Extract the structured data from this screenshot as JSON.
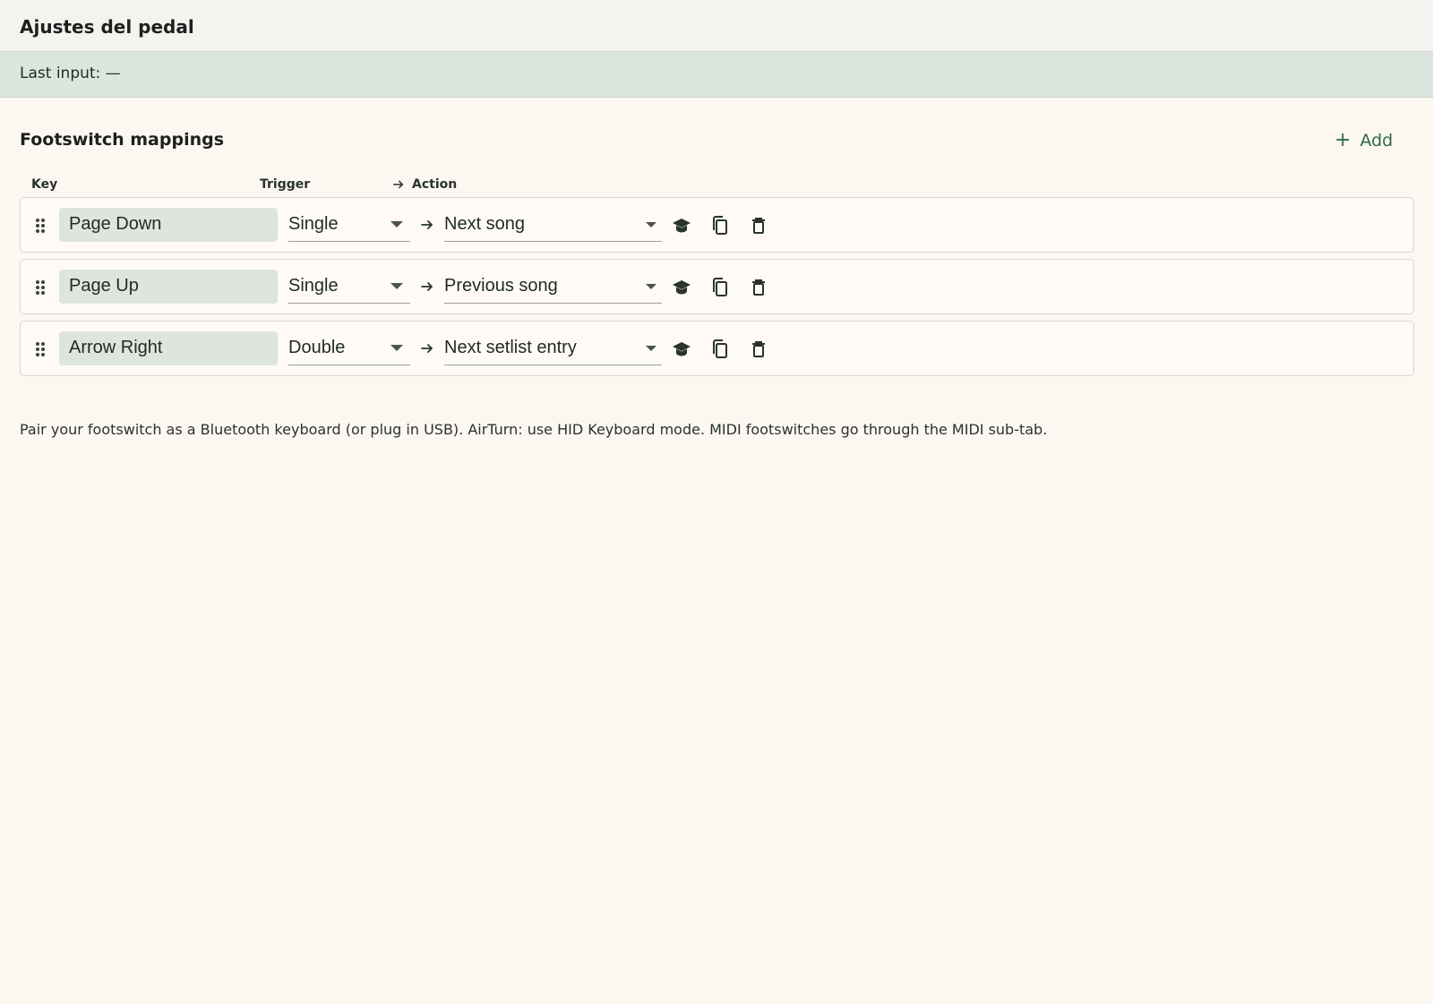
{
  "header": {
    "title": "Ajustes del pedal"
  },
  "status": {
    "text": "Last input: —"
  },
  "section": {
    "title": "Footswitch mappings",
    "add_label": "Add"
  },
  "columns": {
    "key": "Key",
    "trigger": "Trigger",
    "action": "Action"
  },
  "rows": [
    {
      "key": "Page Down",
      "trigger": "Single",
      "action": "Next song"
    },
    {
      "key": "Page Up",
      "trigger": "Single",
      "action": "Previous song"
    },
    {
      "key": "Arrow Right",
      "trigger": "Double",
      "action": "Next setlist entry"
    }
  ],
  "help": {
    "text": "Pair your footswitch as a Bluetooth keyboard (or plug in USB). AirTurn: use HID Keyboard mode. MIDI footswitches go through the MIDI sub-tab."
  },
  "colors": {
    "accent": "#2e6a4c",
    "background": "#fdf7f1",
    "status_bg": "#dde6de"
  },
  "icons": {
    "drag": "drag-handle-icon",
    "arrow": "arrow-right-icon",
    "learn": "graduation-cap-icon",
    "copy": "copy-icon",
    "delete": "trash-icon",
    "add": "plus-icon"
  }
}
